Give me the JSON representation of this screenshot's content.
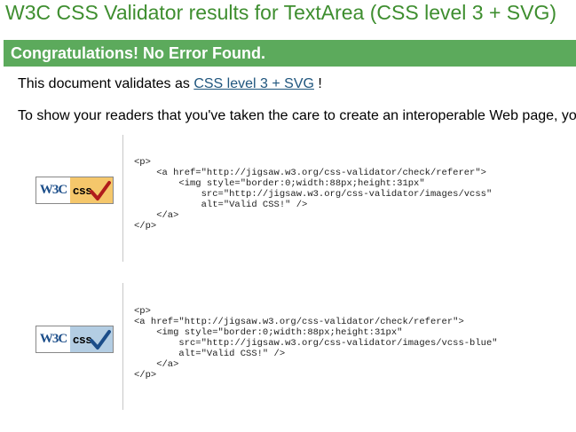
{
  "page": {
    "title": "W3C CSS Validator results for TextArea (CSS level 3 + SVG)",
    "banner": "Congratulations! No Error Found.",
    "validates_prefix": "This document validates as ",
    "validates_link": "CSS level 3 + SVG",
    "validates_suffix": " !",
    "readers_text": "To show your readers that you've taken the care to create an interoperable Web page, yo"
  },
  "badges": [
    {
      "logo": "W3C",
      "label": "css",
      "check_color": "#b01c1c",
      "bg_color": "#f5c76b",
      "code": "<p>\n    <a href=\"http://jigsaw.w3.org/css-validator/check/referer\">\n        <img style=\"border:0;width:88px;height:31px\"\n            src=\"http://jigsaw.w3.org/css-validator/images/vcss\"\n            alt=\"Valid CSS!\" />\n    </a>\n</p>"
    },
    {
      "logo": "W3C",
      "label": "css",
      "check_color": "#1b4d89",
      "bg_color": "#b3cde3",
      "code": "<p>\n<a href=\"http://jigsaw.w3.org/css-validator/check/referer\">\n    <img style=\"border:0;width:88px;height:31px\"\n        src=\"http://jigsaw.w3.org/css-validator/images/vcss-blue\"\n        alt=\"Valid CSS!\" />\n    </a>\n</p>"
    }
  ]
}
